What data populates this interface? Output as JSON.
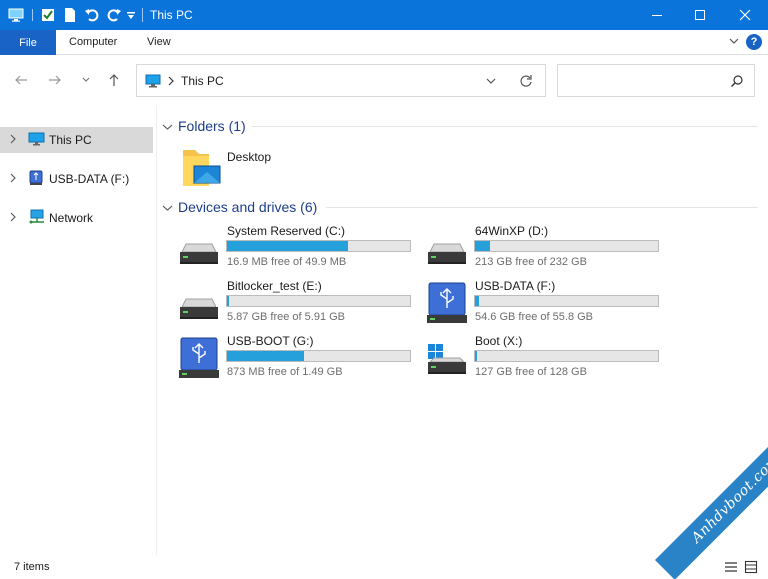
{
  "window": {
    "title": "This PC"
  },
  "ribbon": {
    "tabs": [
      "File",
      "Computer",
      "View"
    ],
    "help": "?"
  },
  "address": {
    "path": "This PC"
  },
  "sidebar": {
    "items": [
      {
        "label": "This PC",
        "icon": "monitor-icon",
        "selected": true
      },
      {
        "label": "USB-DATA (F:)",
        "icon": "usb-drive-icon",
        "selected": false
      },
      {
        "label": "Network",
        "icon": "network-icon",
        "selected": false
      }
    ]
  },
  "folders": {
    "header": "Folders (1)",
    "items": [
      {
        "name": "Desktop",
        "icon": "desktop-folder-icon"
      }
    ]
  },
  "drives": {
    "header": "Devices and drives (6)",
    "items": [
      {
        "name": "System Reserved (C:)",
        "free": "16.9 MB free of 49.9 MB",
        "used_fraction": 0.66,
        "icon": "hdd-icon"
      },
      {
        "name": "64WinXP  (D:)",
        "free": "213 GB free of 232 GB",
        "used_fraction": 0.08,
        "icon": "hdd-icon"
      },
      {
        "name": "Bitlocker_test (E:)",
        "free": "5.87 GB free of 5.91 GB",
        "used_fraction": 0.01,
        "icon": "hdd-icon"
      },
      {
        "name": "USB-DATA (F:)",
        "free": "54.6 GB free of 55.8 GB",
        "used_fraction": 0.02,
        "icon": "usb-drive-icon"
      },
      {
        "name": "USB-BOOT (G:)",
        "free": "873 MB free of 1.49 GB",
        "used_fraction": 0.42,
        "icon": "usb-drive-icon"
      },
      {
        "name": "Boot (X:)",
        "free": "127 GB free of 128 GB",
        "used_fraction": 0.01,
        "icon": "windows-drive-icon"
      }
    ]
  },
  "status": {
    "items_count": "7 items"
  },
  "watermark": {
    "text": "Anhdvboot.com"
  },
  "colors": {
    "titlebar": "#0a74da",
    "file_tab": "#1a63c6",
    "group_title": "#1e3e8c",
    "bar_fill": "#26a0da"
  }
}
